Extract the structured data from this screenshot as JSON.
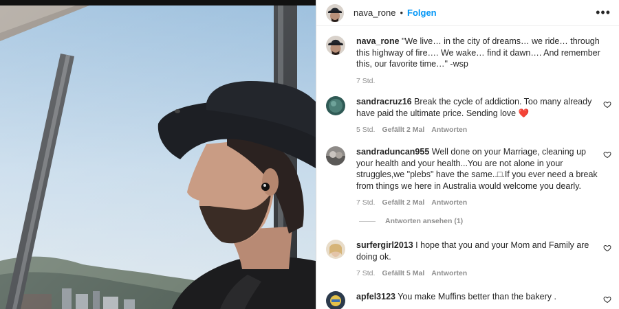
{
  "post": {
    "author": "nava_rone",
    "follow_label": "Folgen",
    "dot": "•",
    "more_icon": "more-icon",
    "caption_text": "\"We live… in the city of dreams… we ride… through this highway of fire…. We wake… find it dawn…. And remember this, our favorite time…\" -wsp",
    "caption_time": "7 Std."
  },
  "comments": [
    {
      "user": "sandracruz16",
      "text": "Break the cycle of addiction. Too many already have paid the ultimate price. Sending love",
      "emoji": "❤️",
      "time": "5 Std.",
      "likes": "Gefällt 2 Mal",
      "reply": "Antworten"
    },
    {
      "user": "sandraduncan955",
      "text": "Well done on your Marriage, cleaning up your health and your health...You are not alone in your struggles,we \"plebs\" have the same..□.If you ever need a break from things we here in Australia would welcome you dearly.",
      "time": "7 Std.",
      "likes": "Gefällt 2 Mal",
      "reply": "Antworten",
      "view_replies": "Antworten ansehen (1)"
    },
    {
      "user": "surfergirl2013",
      "text": "I hope that you and your Mom and Family are doing ok.",
      "time": "7 Std.",
      "likes": "Gefällt 5 Mal",
      "reply": "Antworten"
    },
    {
      "user": "apfel3123",
      "text": "You make Muffins better than the bakery ."
    }
  ],
  "colors": {
    "link": "#0095f6",
    "muted": "#8e8e8e",
    "text": "#262626",
    "heart_red": "#ed4956"
  }
}
